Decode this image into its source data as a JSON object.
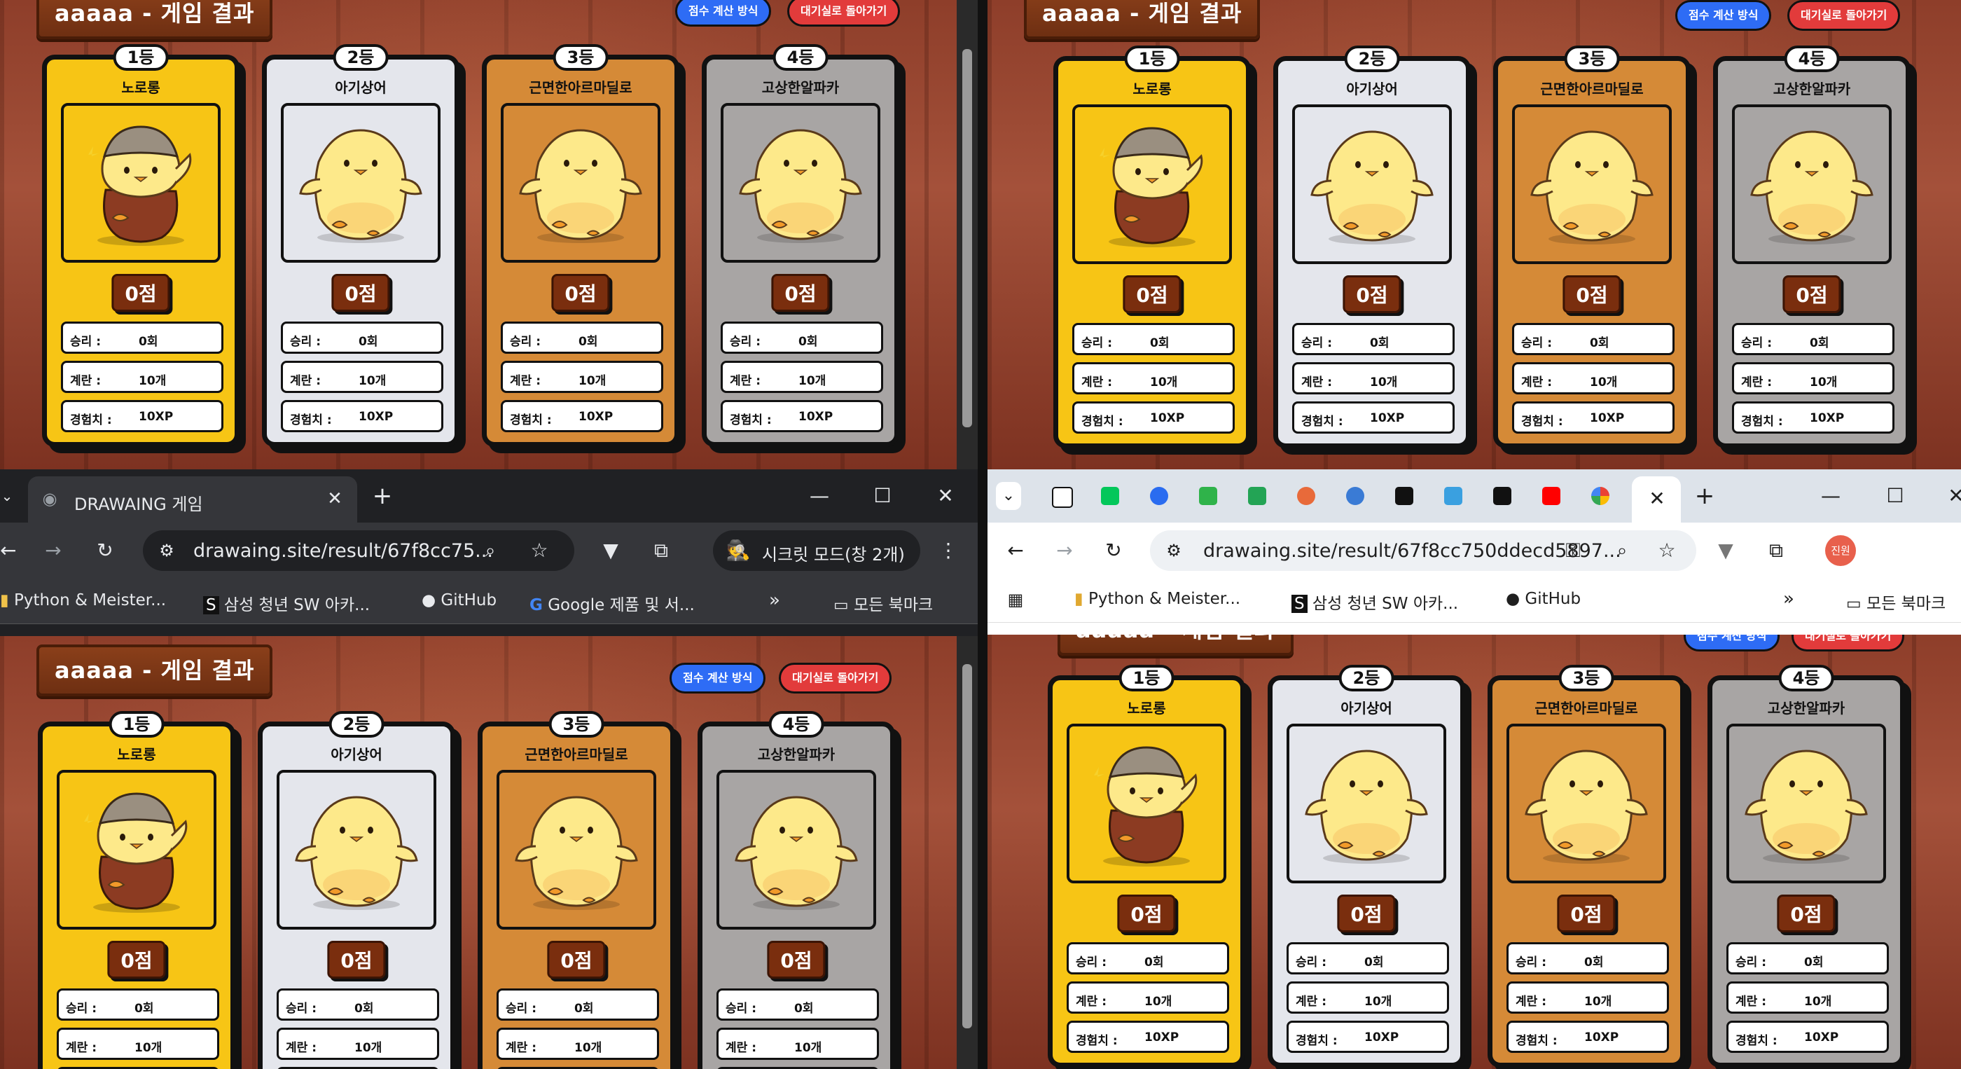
{
  "game": {
    "title": "aaaaa - 게임 결과",
    "score_method_label": "점수 계산 방식",
    "back_label": "대기실로 돌아가기",
    "stat_labels": {
      "wins": "승리 :",
      "eggs": "계란 :",
      "xp": "경험치 :"
    },
    "players": [
      {
        "rank": "1등",
        "name": "노로롱",
        "score": "0점",
        "wins": "0회",
        "eggs": "10개",
        "xp": "10XP",
        "color": "#f7c515",
        "character": "chick-with-beanie"
      },
      {
        "rank": "2등",
        "name": "아기상어",
        "score": "0점",
        "wins": "0회",
        "eggs": "10개",
        "xp": "10XP",
        "color": "#e4e6ec",
        "character": "chick"
      },
      {
        "rank": "3등",
        "name": "근면한아르마딜로",
        "score": "0점",
        "wins": "0회",
        "eggs": "10개",
        "xp": "10XP",
        "color": "#d58a37",
        "character": "chick"
      },
      {
        "rank": "4등",
        "name": "고상한알파카",
        "score": "0점",
        "wins": "0회",
        "eggs": "10개",
        "xp": "10XP",
        "color": "#a8a5a4",
        "character": "chick"
      }
    ]
  },
  "browser_incognito": {
    "tab_title": "DRAWAING 게임",
    "url": "drawaing.site/result/67f8cc75...",
    "incognito_label": "시크릿 모드(창 2개)",
    "bookmarks": [
      "Python & Meister...",
      "삼성 청년 SW 아카...",
      "GitHub",
      "Google 제품 및 서..."
    ],
    "bookmarks_all": "모든 북마크"
  },
  "browser_normal": {
    "url": "drawaing.site/result/67f8cc750ddecd5897...",
    "profile_label": "진원",
    "bookmarks": [
      "Python & Meister...",
      "삼성 청년 SW 아카...",
      "GitHub"
    ],
    "bookmarks_all": "모든 북마크"
  },
  "colors": {
    "accent_blue": "#2e6cf5",
    "accent_red": "#e23b3b",
    "score_brown": "#7a2e0e"
  }
}
